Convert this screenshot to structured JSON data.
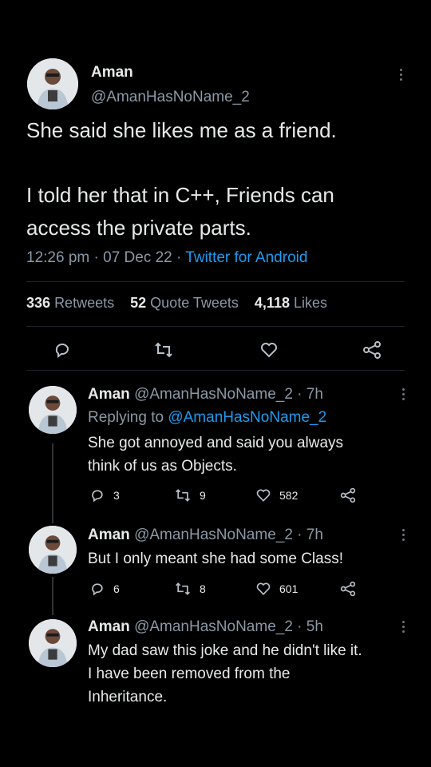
{
  "main_tweet": {
    "display_name": "Aman",
    "handle": "@AmanHasNoName_2",
    "text_line1": "She said she likes me as a friend.",
    "text_line2": "I told her that in C++, Friends can",
    "text_line3": "access the private parts.",
    "time": "12:26 pm",
    "date": "07 Dec 22",
    "sep": "·",
    "source": "Twitter for Android",
    "retweets_count": "336",
    "retweets_label": "Retweets",
    "quotes_count": "52",
    "quotes_label": "Quote Tweets",
    "likes_count": "4,118",
    "likes_label": "Likes"
  },
  "replies": [
    {
      "name": "Aman",
      "handle_time": "@AmanHasNoName_2 · 7h",
      "replying_prefix": "Replying to",
      "replying_handle": "@AmanHasNoName_2",
      "line1": "She got annoyed and said you always",
      "line2": "think of us as Objects.",
      "replies": "3",
      "retweets": "9",
      "likes": "582"
    },
    {
      "name": "Aman",
      "handle_time": "@AmanHasNoName_2 · 7h",
      "line1": "But I only meant she had some Class!",
      "replies": "6",
      "retweets": "8",
      "likes": "601"
    },
    {
      "name": "Aman",
      "handle_time": "@AmanHasNoName_2 · 5h",
      "line1": "My dad saw this joke and he didn't like it.",
      "line2": "I have been removed from the",
      "line3": "Inheritance."
    }
  ],
  "colors": {
    "background": "#000000",
    "text": "#e7e9ea",
    "muted": "#8b98a5",
    "link": "#1d9bf0"
  },
  "icons": [
    "reply-icon",
    "retweet-icon",
    "like-icon",
    "share-icon",
    "more-icon"
  ]
}
